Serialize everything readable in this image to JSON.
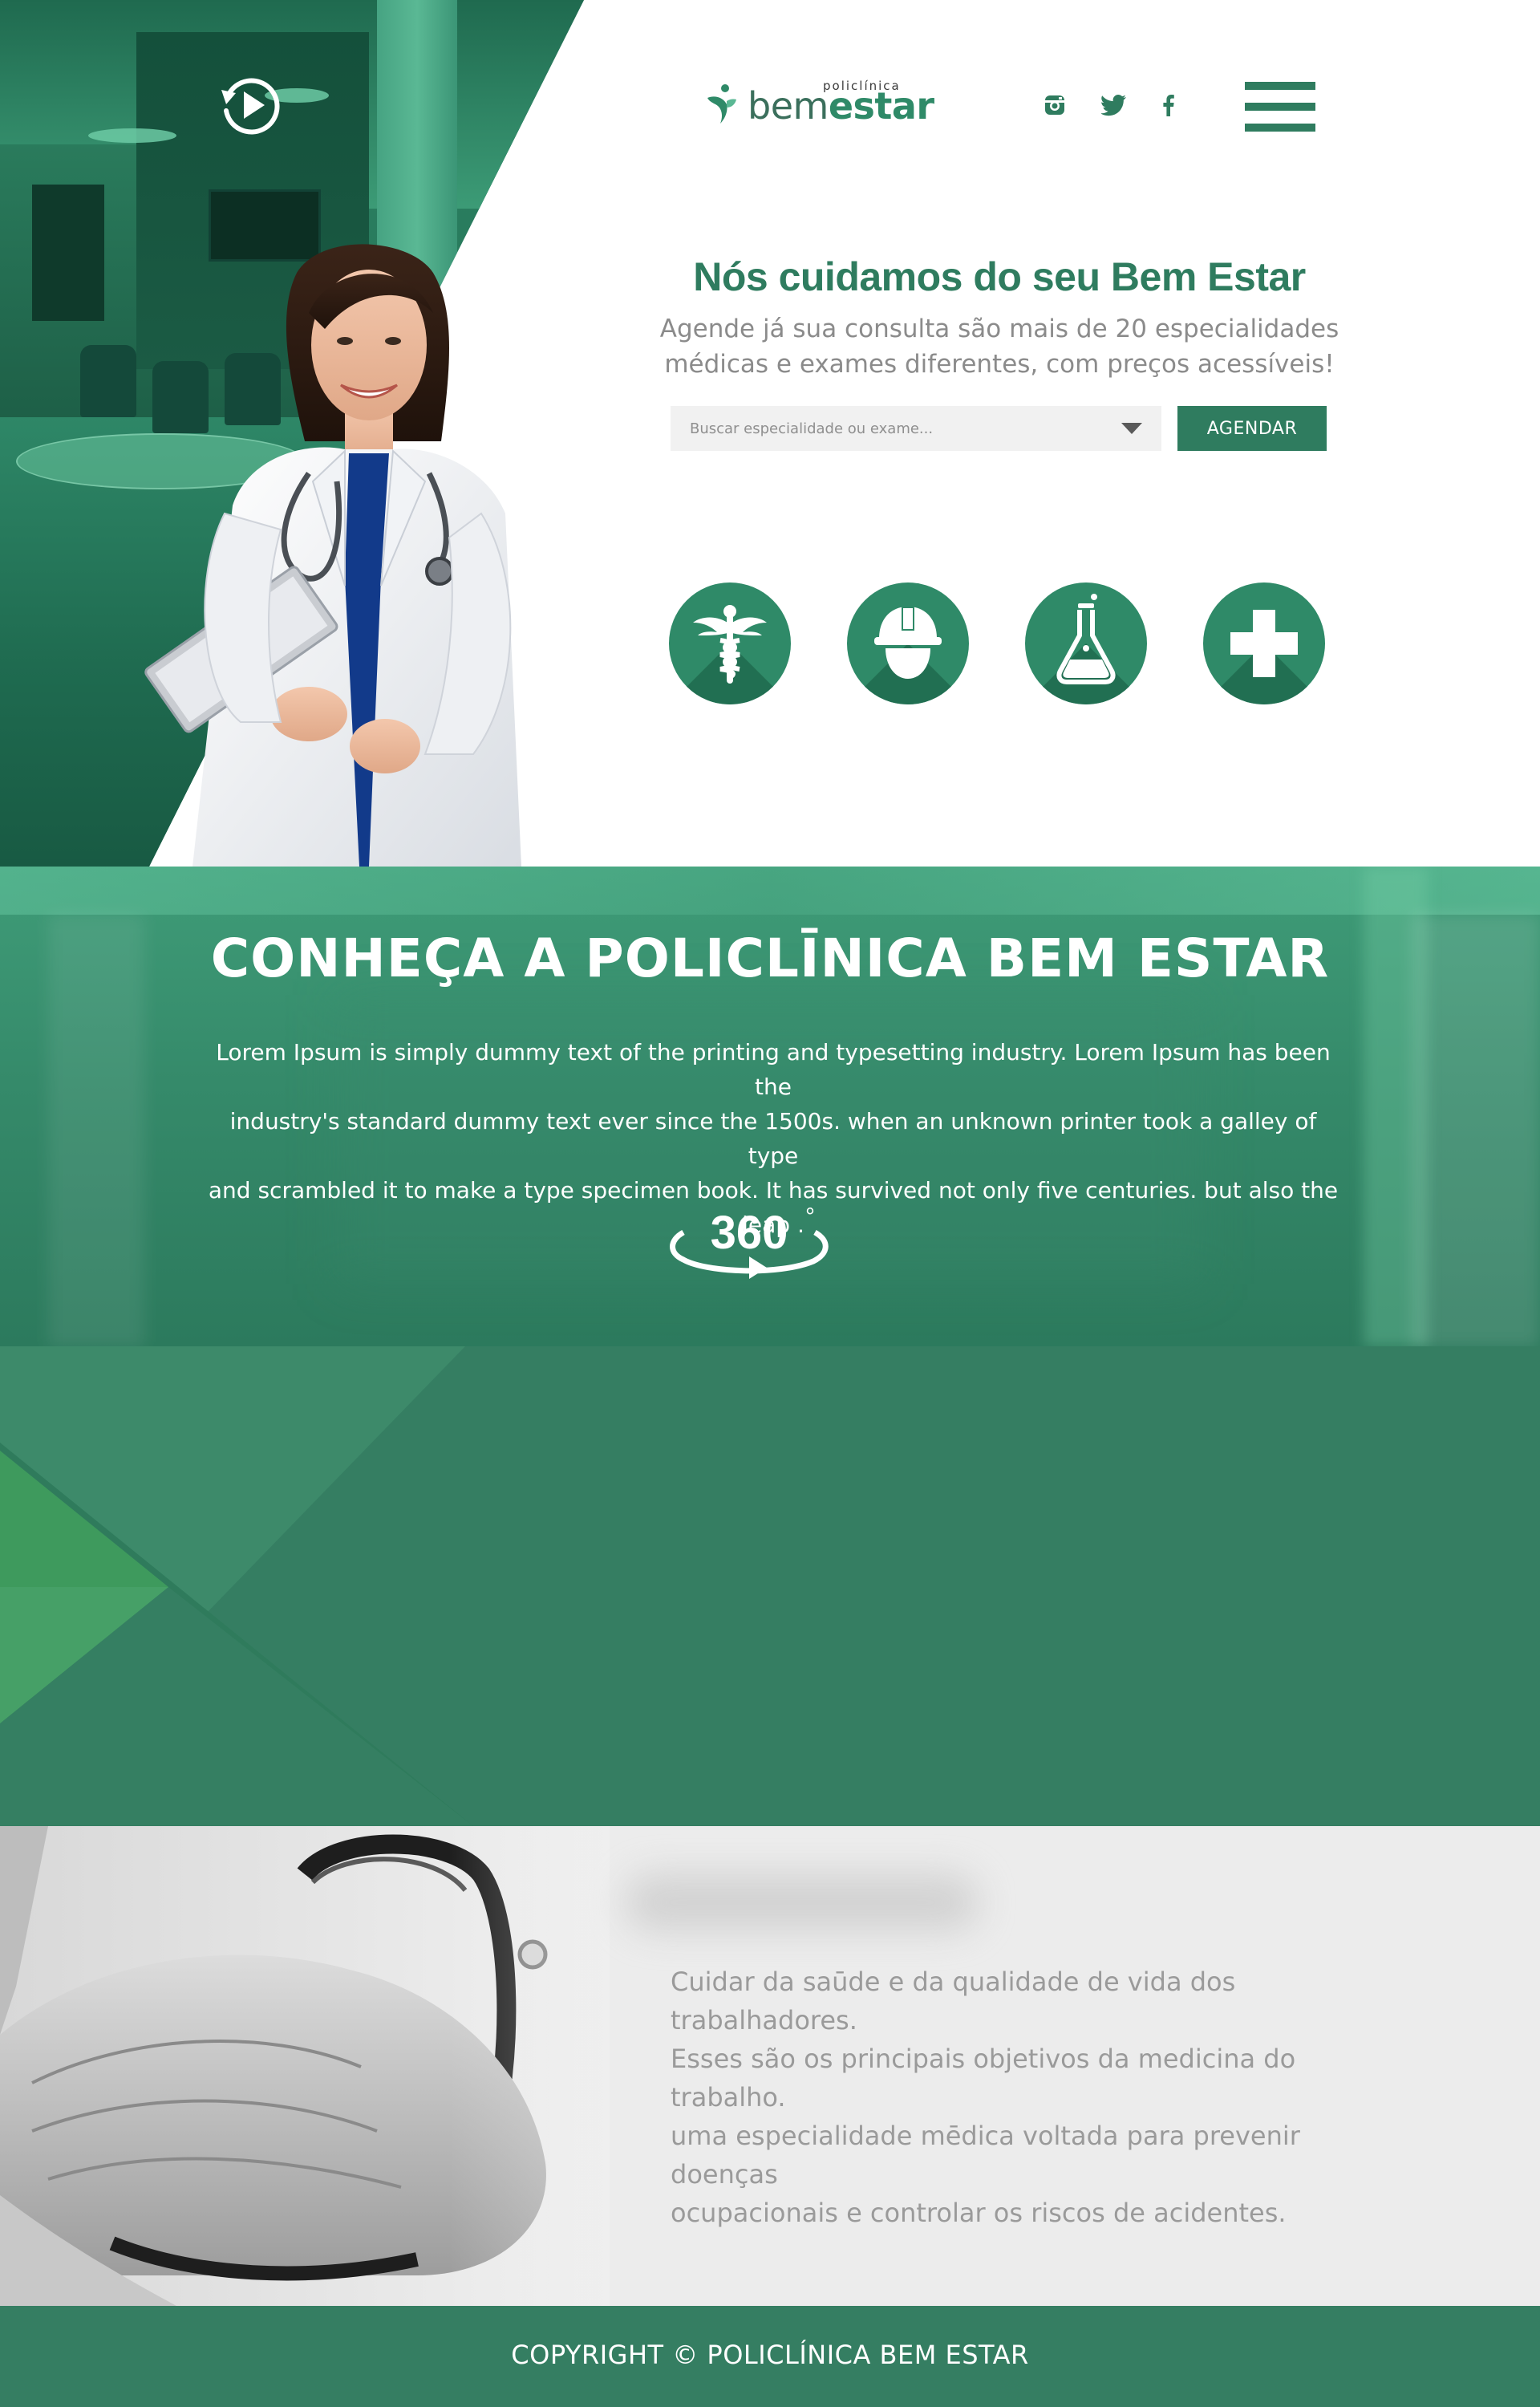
{
  "brand": {
    "small": "policlínica",
    "main_part1": "bem",
    "main_part2": "estar",
    "logo_icon": "leaf-person-icon"
  },
  "header": {
    "social": [
      {
        "name": "instagram",
        "icon": "instagram-icon"
      },
      {
        "name": "twitter",
        "icon": "twitter-icon"
      },
      {
        "name": "facebook",
        "icon": "facebook-icon"
      }
    ],
    "menu_icon": "hamburger-menu-icon",
    "video_icon": "replay-play-icon"
  },
  "hero": {
    "title": "Nós cuidamos do seu Bem Estar",
    "subtitle_line1": "Agende já sua consulta são mais de 20 especialidades",
    "subtitle_line2": "médicas e exames diferentes, com preços acessíveis!",
    "search_placeholder": "Buscar especialidade ou exame...",
    "button_label": "AGENDAR",
    "services": [
      {
        "icon": "caduceus-icon"
      },
      {
        "icon": "worker-helmet-icon"
      },
      {
        "icon": "lab-flask-icon"
      },
      {
        "icon": "medical-cross-icon"
      }
    ]
  },
  "about": {
    "title": "CONHEÇA A POLICLĪNICA BEM ESTAR",
    "text_line1": "Lorem Ipsum is simply dummy text of the printing and typesetting industry. Lorem Ipsum has been the",
    "text_line2": "industry's standard dummy text ever since the 1500s. when an unknown printer took a galley of type",
    "text_line3": "and scrambled it to make a type specimen book. It has survived not only five centuries. but also the leap .",
    "tour_label": "360",
    "tour_degree": "°"
  },
  "work": {
    "line1": "Cuidar da saūde e da qualidade de vida dos trabalhadores.",
    "line2": "Esses são os principais objetivos da medicina do trabalho.",
    "line3": "uma especialidade mēdica voltada para prevenir doenças",
    "line4": "ocupacionais e controlar os riscos de acidentes."
  },
  "footer": {
    "copyright": "COPYRIGHT © POLICLÍNICA BEM ESTAR"
  },
  "colors": {
    "brand_green": "#2f7c5f",
    "accent_green": "#2f8a68",
    "dark_green": "#357e62",
    "text_gray": "#8b8b8b",
    "white": "#ffffff"
  }
}
